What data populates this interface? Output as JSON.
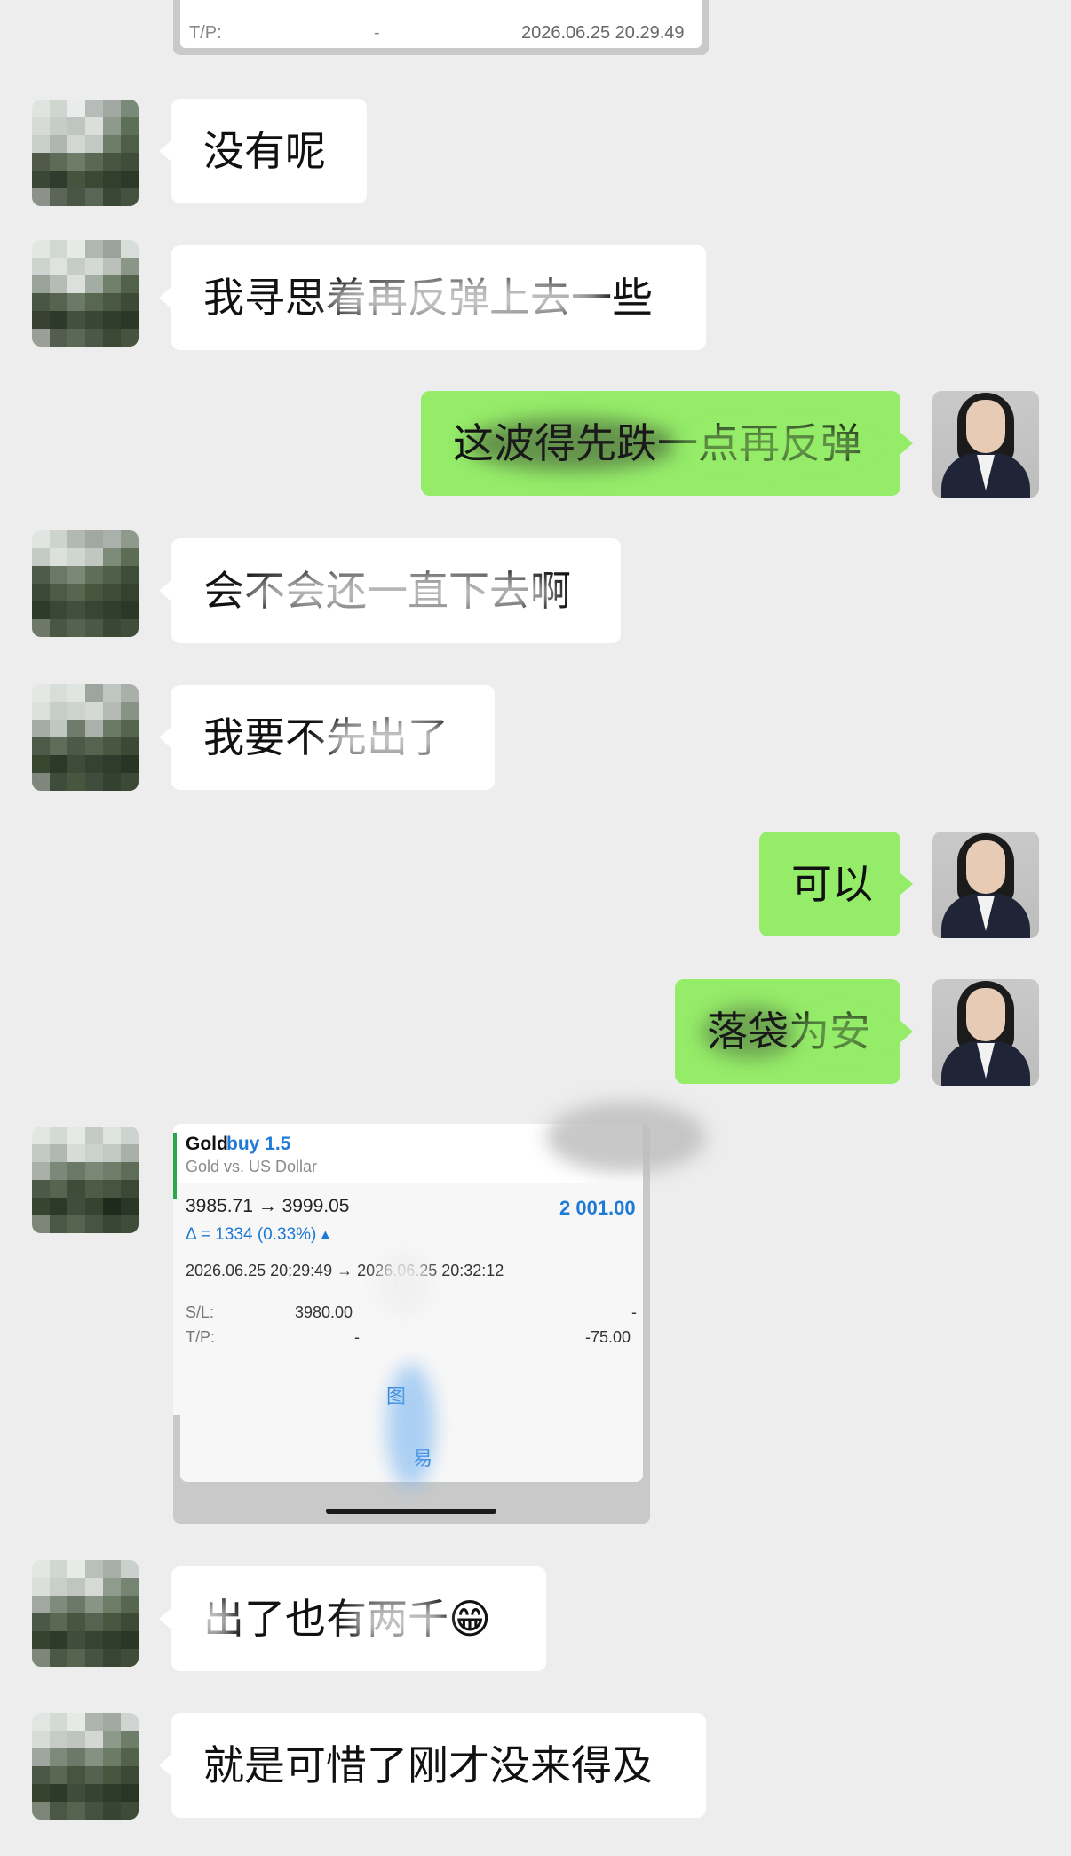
{
  "top_card": {
    "tp_label": "T/P:",
    "tp_value": "-",
    "datetime": "2026.06.25 20.29.49"
  },
  "messages": [
    {
      "side": "in",
      "text": "没有呢"
    },
    {
      "side": "in",
      "text": "我寻思着再反弹上去一些"
    },
    {
      "side": "out",
      "text": "这波得先跌一点再反弹"
    },
    {
      "side": "in",
      "text": "会不会还一直下去啊"
    },
    {
      "side": "in",
      "text": "我要不先出了"
    },
    {
      "side": "out",
      "text": "可以"
    },
    {
      "side": "out",
      "text": "落袋为安"
    },
    {
      "side": "in",
      "text": "出了也有两千😁"
    },
    {
      "side": "in",
      "text": "就是可惜了刚才没来得及"
    }
  ],
  "trade_card": {
    "symbol": "Gold",
    "action": "buy 1.5",
    "description": "Gold vs. US Dollar",
    "price_range": "3985.71 → 3999.05",
    "profit": "2 001.00",
    "delta": "Δ = 1334 (0.33%) ▴",
    "time_range": "2026.06.25 20:29:49 → 2026.06.25 20:32:12",
    "sl_label": "S/L:",
    "sl_value": "3980.00",
    "tp_label": "T/P:",
    "tp_value": "-",
    "right_value": "-",
    "swap_value": "-75.00",
    "chart_label": "图",
    "trade_label": "易"
  },
  "colors": {
    "background": "#ededed",
    "incoming_bubble": "#ffffff",
    "outgoing_bubble": "#95ec69",
    "link_blue": "#1e7ad6",
    "green_accent": "#2aa84a"
  }
}
